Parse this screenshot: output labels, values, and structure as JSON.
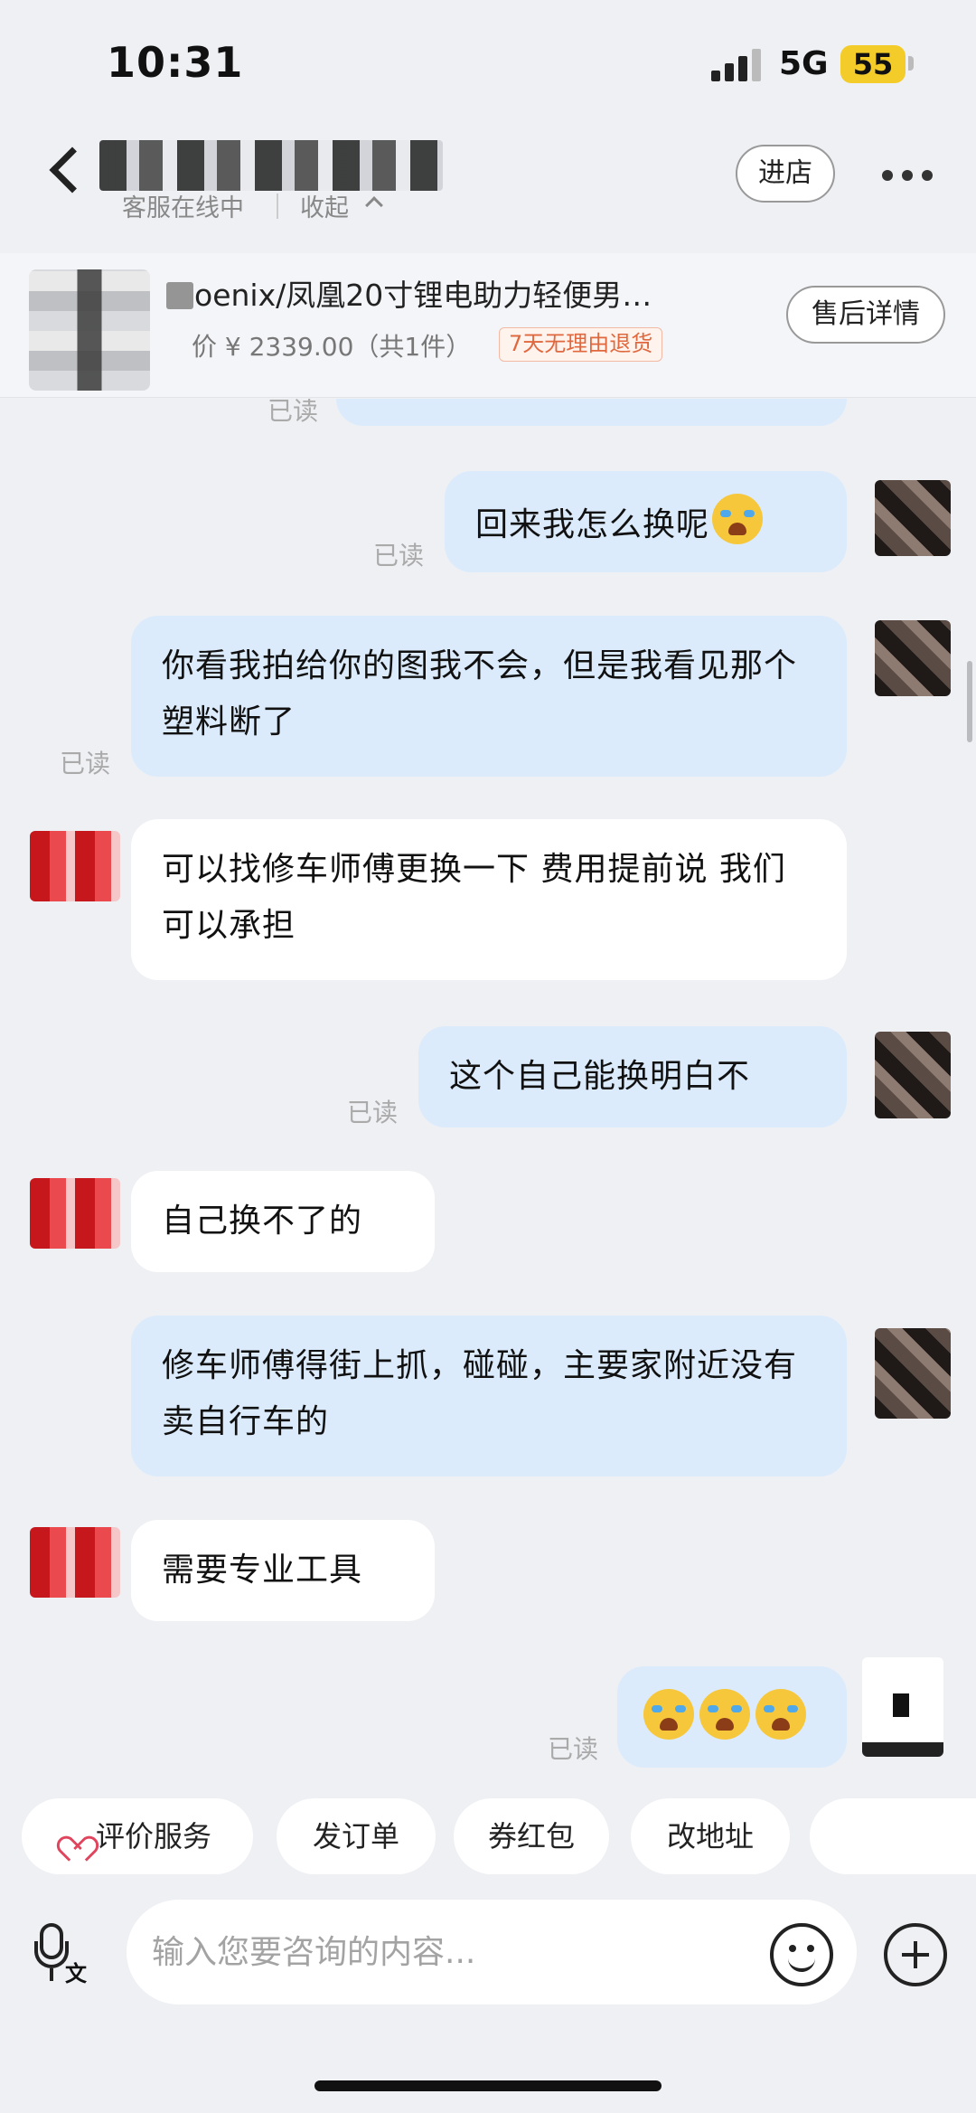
{
  "status_bar": {
    "time": "10:31",
    "network": "5G",
    "battery": "55",
    "battery_color": "#f3cc2a"
  },
  "header": {
    "back_icon": "chevron-left-icon",
    "customer_service_status": "客服在线中",
    "collapse_label": "收起",
    "enter_shop_label": "进店",
    "more_icon": "more-horizontal-icon"
  },
  "product": {
    "title": "oenix/凤凰20寸锂电助力轻便男…",
    "price": "价 ¥ 2339.00（共1件）",
    "return_badge": "7天无理由退货",
    "after_sale_label": "售后详情"
  },
  "chat": {
    "read_label": "已读",
    "messages": [
      {
        "from": "user",
        "text": "回来我怎么换呢",
        "emoji": "crying-laughing-emoji",
        "read": true
      },
      {
        "from": "user",
        "text": "你看我拍给你的图我不会，但是我看见那个塑料断了",
        "read": true
      },
      {
        "from": "shop",
        "text": "可以找修车师傅更换一下 费用提前说 我们可以承担"
      },
      {
        "from": "user",
        "text": "这个自己能换明白不",
        "read": true
      },
      {
        "from": "shop",
        "text": "自己换不了的"
      },
      {
        "from": "user",
        "text": "修车师傅得街上抓，碰碰，主要家附近没有卖自行车的",
        "read": false
      },
      {
        "from": "shop",
        "text": "需要专业工具"
      },
      {
        "from": "user",
        "text": "",
        "emoji": "loudly-crying-emoji ×3",
        "read": true
      }
    ]
  },
  "quick_actions": [
    "评价服务",
    "发订单",
    "券红包",
    "改地址"
  ],
  "input": {
    "placeholder": "输入您要咨询的内容...",
    "voice_icon": "microphone-icon",
    "voice_tag": "文",
    "emoji_icon": "smile-icon",
    "add_icon": "plus-circle-icon"
  },
  "colors": {
    "outgoing_bubble": "#dcebfb",
    "incoming_bubble": "#ffffff",
    "background": "#eef0f4",
    "badge_text": "#e0683e"
  }
}
